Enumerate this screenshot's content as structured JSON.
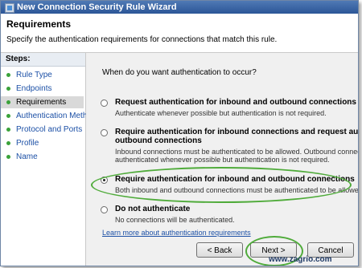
{
  "window": {
    "title": "New Connection Security Rule Wizard"
  },
  "header": {
    "title": "Requirements",
    "description": "Specify the authentication requirements for connections that match this rule."
  },
  "steps": {
    "header": "Steps:",
    "items": [
      "Rule Type",
      "Endpoints",
      "Requirements",
      "Authentication Method",
      "Protocol and Ports",
      "Profile",
      "Name"
    ],
    "active_index": 2
  },
  "main": {
    "question": "When do you want authentication to occur?",
    "options": [
      {
        "title": "Request authentication for inbound and outbound connections",
        "desc": [
          "Authenticate whenever possible but authentication is not required."
        ],
        "selected": false
      },
      {
        "title": "Require authentication for inbound connections and request authentica",
        "title2": "outbound connections",
        "desc": [
          "Inbound connections must be authenticated to be allowed. Outbound connections an",
          "authenticated whenever possible but authentication is not required."
        ],
        "selected": false
      },
      {
        "title": "Require authentication for inbound and outbound connections",
        "desc": [
          "Both inbound and outbound connections must be authenticated to be allowed."
        ],
        "selected": true
      },
      {
        "title": "Do not authenticate",
        "desc": [
          "No connections will be authenticated."
        ],
        "selected": false
      }
    ],
    "learn_link": "Learn more about authentication requirements"
  },
  "buttons": {
    "back": "< Back",
    "next": "Next >",
    "cancel": "Cancel"
  },
  "watermark": "www.zagrio.com",
  "colors": {
    "highlight": "#4fab3a",
    "link": "#1c50a6",
    "bullet": "#3aa23a"
  }
}
